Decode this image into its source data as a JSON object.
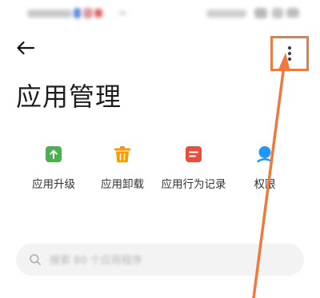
{
  "status_bar": {
    "left_text": "",
    "right_text": "",
    "icons": [
      "network-icon",
      "notification-icon",
      "wifi-icon",
      "signal-icon",
      "battery-icon"
    ]
  },
  "header": {
    "back_icon": "arrow-left-icon",
    "more_icon": "more-vertical-icon"
  },
  "page_title": "应用管理",
  "shortcuts": [
    {
      "label": "应用升级",
      "icon": "upgrade-icon",
      "color": "#4caf50"
    },
    {
      "label": "应用卸载",
      "icon": "trash-icon",
      "color": "#ff9800"
    },
    {
      "label": "应用行为记录",
      "icon": "record-icon",
      "color": "#e94e3c"
    },
    {
      "label": "权限",
      "icon": "permission-icon",
      "color": "#2196f3"
    }
  ],
  "search": {
    "placeholder": "搜索 80 个应用程序",
    "icon": "search-icon"
  },
  "annotation": {
    "highlight_color": "#ef7a3e",
    "target": "more-button"
  }
}
